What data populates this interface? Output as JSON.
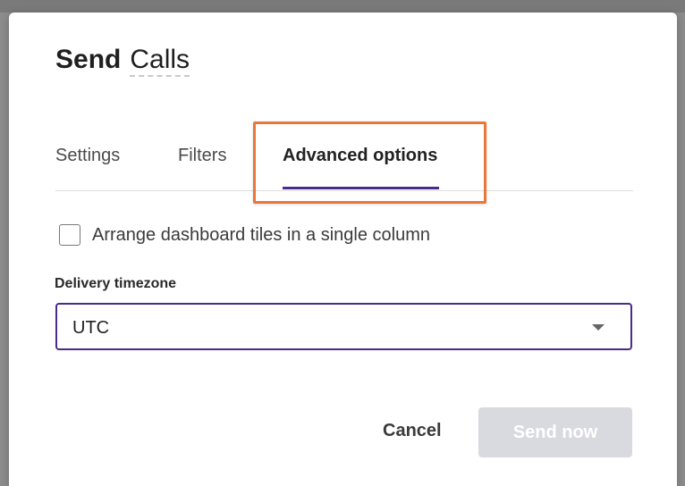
{
  "dialog": {
    "title_verb": "Send",
    "title_target": "Calls"
  },
  "tabs": [
    {
      "label": "Settings",
      "active": false
    },
    {
      "label": "Filters",
      "active": false
    },
    {
      "label": "Advanced options",
      "active": true
    }
  ],
  "advanced": {
    "single_column_label": "Arrange dashboard tiles in a single column",
    "single_column_checked": false,
    "timezone_label": "Delivery timezone",
    "timezone_value": "UTC"
  },
  "footer": {
    "cancel_label": "Cancel",
    "send_label": "Send now",
    "send_enabled": false
  },
  "colors": {
    "accent": "#4a2b8a",
    "highlight": "#e8773a",
    "disabled_button": "#d9d9e0"
  },
  "icons": {
    "select_caret": "caret-down-icon"
  }
}
